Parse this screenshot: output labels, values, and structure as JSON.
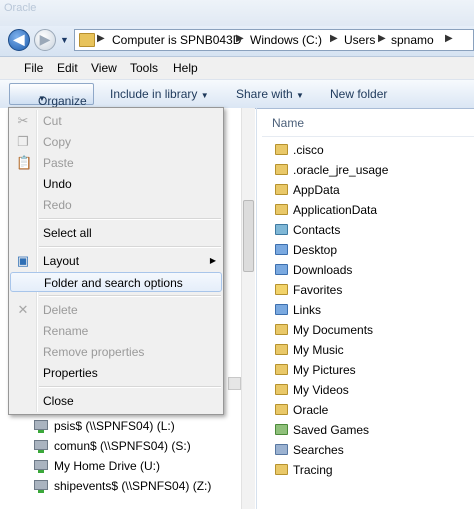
{
  "ghost_text": "Oracle",
  "address": {
    "crumbs": [
      "Computer is SPNB043D",
      "Windows (C:)",
      "Users",
      "spnamo"
    ],
    "sep": "▶"
  },
  "menubar": [
    "File",
    "Edit",
    "View",
    "Tools",
    "Help"
  ],
  "commands": {
    "organize": "Organize",
    "include": "Include in library",
    "share": "Share with",
    "newfolder": "New folder"
  },
  "content": {
    "column_header": "Name",
    "items": [
      ".cisco",
      ".oracle_jre_usage",
      "AppData",
      "ApplicationData",
      "Contacts",
      "Desktop",
      "Downloads",
      "Favorites",
      "Links",
      "My Documents",
      "My Music",
      "My Pictures",
      "My Videos",
      "Oracle",
      "Saved Games",
      "Searches",
      "Tracing"
    ],
    "icons": [
      "folder-icon",
      "folder-icon",
      "folder-icon",
      "folder-icon",
      "contacts-icon",
      "desktop-icon",
      "downloads-icon",
      "favorites-icon",
      "links-icon",
      "folder-icon",
      "folder-icon",
      "folder-icon",
      "folder-icon",
      "folder-icon",
      "saved-games-icon",
      "searches-icon",
      "folder-icon"
    ]
  },
  "drives": [
    "psis$ (\\\\SPNFS04) (L:)",
    "comun$ (\\\\SPNFS04) (S:)",
    "My Home Drive (U:)",
    "shipevents$ (\\\\SPNFS04) (Z:)"
  ],
  "menu": {
    "cut": "Cut",
    "copy": "Copy",
    "paste": "Paste",
    "undo": "Undo",
    "redo": "Redo",
    "select_all": "Select all",
    "layout": "Layout",
    "folder_options": "Folder and search options",
    "delete": "Delete",
    "rename": "Rename",
    "remove_properties": "Remove properties",
    "properties": "Properties",
    "close": "Close"
  }
}
